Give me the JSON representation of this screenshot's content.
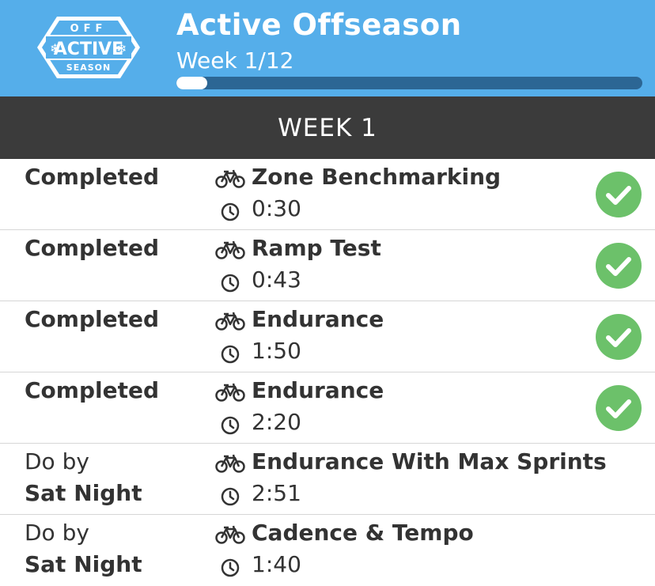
{
  "header": {
    "logo_top": "OFF",
    "logo_main": "ACTIVE",
    "logo_bottom": "SEASON",
    "title": "Active Offseason",
    "week_label": "Week 1/12",
    "progress_fraction": 0.0667,
    "colors": {
      "background": "#55aeea",
      "progress_track": "#2c6694",
      "progress_fill": "#ffffff"
    }
  },
  "week_banner": {
    "label": "WEEK 1",
    "color": "#3b3b3b"
  },
  "workouts": [
    {
      "status": "Completed",
      "status_line1": "",
      "status_line2": "",
      "name": "Zone Benchmarking",
      "duration": "0:30",
      "completed": true
    },
    {
      "status": "Completed",
      "status_line1": "",
      "status_line2": "",
      "name": "Ramp Test",
      "duration": "0:43",
      "completed": true
    },
    {
      "status": "Completed",
      "status_line1": "",
      "status_line2": "",
      "name": "Endurance",
      "duration": "1:50",
      "completed": true
    },
    {
      "status": "Completed",
      "status_line1": "",
      "status_line2": "",
      "name": "Endurance",
      "duration": "2:20",
      "completed": true
    },
    {
      "status": "",
      "status_line1": "Do by",
      "status_line2": "Sat Night",
      "name": "Endurance With Max Sprints",
      "duration": "2:51",
      "completed": false
    },
    {
      "status": "",
      "status_line1": "Do by",
      "status_line2": "Sat Night",
      "name": "Cadence & Tempo",
      "duration": "1:40",
      "completed": false
    }
  ],
  "icons": {
    "workout": "bicycle-icon",
    "duration": "clock-icon",
    "done": "check-circle-icon"
  },
  "colors": {
    "check": "#6cc16a",
    "text": "#333333",
    "divider": "#d6d6d6"
  }
}
